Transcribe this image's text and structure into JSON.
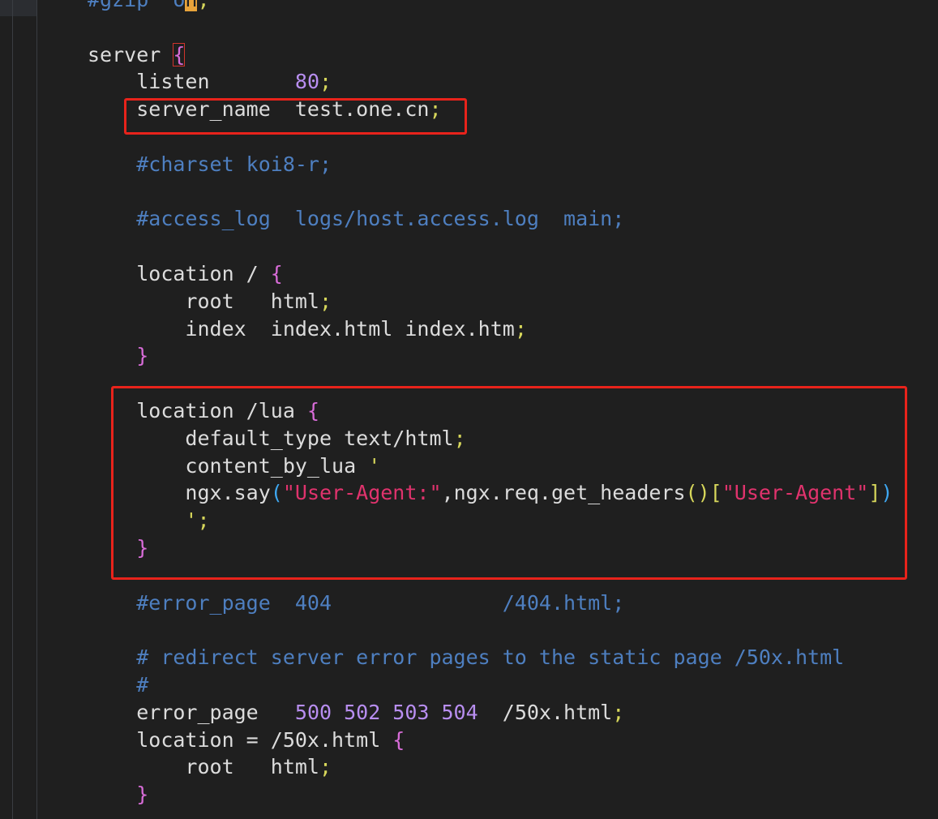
{
  "editor": {
    "colors": {
      "background": "#1f1f1f",
      "comment": "#4e7fc0",
      "number": "#b88ef0",
      "punctuation": "#d7d75b",
      "brace": "#d86cd8",
      "string": "#e0336d",
      "paren": "#3ea7f0",
      "annotation_box": "#e8231b"
    },
    "lines": [
      {
        "indent": "",
        "tokens": [
          [
            "comment",
            "#gzip  o"
          ],
          [
            "cursor",
            "n"
          ],
          [
            "punct",
            ";"
          ]
        ]
      },
      {
        "indent": "",
        "tokens": []
      },
      {
        "indent": "",
        "tokens": [
          [
            "plain",
            "server "
          ],
          [
            "brace-match",
            "{"
          ]
        ]
      },
      {
        "indent": "    ",
        "tokens": [
          [
            "plain",
            "listen       "
          ],
          [
            "num",
            "80"
          ],
          [
            "punct",
            ";"
          ]
        ]
      },
      {
        "indent": "    ",
        "tokens": [
          [
            "plain",
            "server_name  test.one.cn"
          ],
          [
            "punct",
            ";"
          ]
        ]
      },
      {
        "indent": "",
        "tokens": []
      },
      {
        "indent": "    ",
        "tokens": [
          [
            "comment",
            "#charset koi8-r;"
          ]
        ]
      },
      {
        "indent": "",
        "tokens": []
      },
      {
        "indent": "    ",
        "tokens": [
          [
            "comment",
            "#access_log  logs/host.access.log  main;"
          ]
        ]
      },
      {
        "indent": "",
        "tokens": []
      },
      {
        "indent": "    ",
        "tokens": [
          [
            "plain",
            "location / "
          ],
          [
            "brace",
            "{"
          ]
        ]
      },
      {
        "indent": "        ",
        "tokens": [
          [
            "plain",
            "root   html"
          ],
          [
            "punct",
            ";"
          ]
        ]
      },
      {
        "indent": "        ",
        "tokens": [
          [
            "plain",
            "index  index.html index.htm"
          ],
          [
            "punct",
            ";"
          ]
        ]
      },
      {
        "indent": "    ",
        "tokens": [
          [
            "brace",
            "}"
          ]
        ]
      },
      {
        "indent": "",
        "tokens": []
      },
      {
        "indent": "    ",
        "tokens": [
          [
            "plain",
            "location /lua "
          ],
          [
            "brace",
            "{"
          ]
        ]
      },
      {
        "indent": "        ",
        "tokens": [
          [
            "plain",
            "default_type text/html"
          ],
          [
            "punct",
            ";"
          ]
        ]
      },
      {
        "indent": "        ",
        "tokens": [
          [
            "plain",
            "content_by_lua "
          ],
          [
            "punct",
            "'"
          ]
        ]
      },
      {
        "indent": "        ",
        "tokens": [
          [
            "plain",
            "ngx.say"
          ],
          [
            "paren",
            "("
          ],
          [
            "str",
            "\"User-Agent:\""
          ],
          [
            "plain",
            ",ngx.req.get_headers"
          ],
          [
            "bracket",
            "()"
          ],
          [
            "bracket",
            "["
          ],
          [
            "str",
            "\"User-Agent\""
          ],
          [
            "bracket",
            "]"
          ],
          [
            "paren",
            ")"
          ]
        ]
      },
      {
        "indent": "        ",
        "tokens": [
          [
            "punct",
            "';"
          ]
        ]
      },
      {
        "indent": "    ",
        "tokens": [
          [
            "brace",
            "}"
          ]
        ]
      },
      {
        "indent": "",
        "tokens": []
      },
      {
        "indent": "    ",
        "tokens": [
          [
            "comment",
            "#error_page  404              /404.html;"
          ]
        ]
      },
      {
        "indent": "",
        "tokens": []
      },
      {
        "indent": "    ",
        "tokens": [
          [
            "comment",
            "# redirect server error pages to the static page /50x.html"
          ]
        ]
      },
      {
        "indent": "    ",
        "tokens": [
          [
            "comment",
            "#"
          ]
        ]
      },
      {
        "indent": "    ",
        "tokens": [
          [
            "plain",
            "error_page   "
          ],
          [
            "num",
            "500 502 503 504"
          ],
          [
            "plain",
            "  /50x.html"
          ],
          [
            "punct",
            ";"
          ]
        ]
      },
      {
        "indent": "    ",
        "tokens": [
          [
            "plain",
            "location = /50x.html "
          ],
          [
            "brace",
            "{"
          ]
        ]
      },
      {
        "indent": "        ",
        "tokens": [
          [
            "plain",
            "root   html"
          ],
          [
            "punct",
            ";"
          ]
        ]
      },
      {
        "indent": "    ",
        "tokens": [
          [
            "brace",
            "}"
          ]
        ]
      }
    ]
  }
}
